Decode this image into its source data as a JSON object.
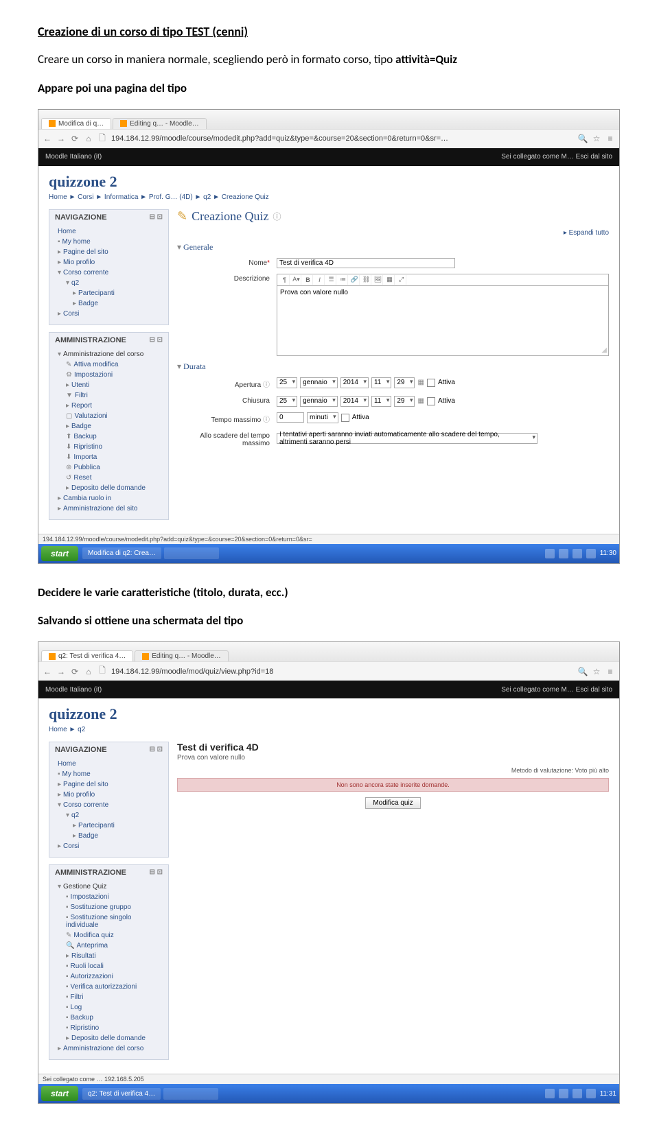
{
  "doc": {
    "heading": "Creazione di un corso di tipo TEST (cenni)",
    "para1_a": "Creare un corso in maniera normale, scegliendo però in formato corso, tipo ",
    "para1_b": "attività=Quiz",
    "para2": "Appare poi una pagina del tipo",
    "para3": "Decidere le varie caratteristiche (titolo, durata, ecc.)",
    "para4": "Salvando si ottiene una schermata del tipo"
  },
  "shot1": {
    "tabs": {
      "t1": "Modifica di q…",
      "t2": "Editing q… - Moodle…"
    },
    "url": "194.184.12.99/moodle/course/modedit.php?add=quiz&type=&course=20&section=0&return=0&sr=…",
    "blackbar_left": "Moodle    Italiano (it)",
    "blackbar_right": "Sei collegato come M…   Esci dal sito",
    "pageTitle": "quizzone 2",
    "breadcrumb": "Home ► Corsi ► Informatica ► Prof. G… (4D) ► q2 ► Creazione Quiz",
    "nav": {
      "header": "NAVIGAZIONE",
      "items": [
        "Home",
        "My home",
        "Pagine del sito",
        "Mio profilo",
        "Corso corrente"
      ],
      "sub": [
        "q2",
        "Partecipanti",
        "Badge"
      ],
      "last": "Corsi"
    },
    "admin": {
      "header": "AMMINISTRAZIONE",
      "head2": "Amministrazione del corso",
      "items": [
        "Attiva modifica",
        "Impostazioni",
        "Utenti",
        "Filtri",
        "Report",
        "Valutazioni",
        "Badge",
        "Backup",
        "Ripristino",
        "Importa",
        "Pubblica",
        "Reset",
        "Deposito delle domande"
      ],
      "tail": [
        "Cambia ruolo in",
        "Amministrazione del sito"
      ]
    },
    "mainHeading": "Creazione Quiz",
    "expand": "▸ Espandi tutto",
    "sec_general": "Generale",
    "lbl_nome": "Nome",
    "val_nome": "Test di verifica 4D",
    "lbl_desc": "Descrizione",
    "val_desc": "Prova con valore nullo",
    "sec_durata": "Durata",
    "lbl_apertura": "Apertura",
    "lbl_chiusura": "Chiusura",
    "lbl_tempomax": "Tempo massimo",
    "lbl_scadere": "Allo scadere del tempo massimo",
    "val_scadere": "I tentativi aperti saranno inviati automaticamente allo scadere del tempo, altrimenti saranno persi",
    "date": {
      "d": "25",
      "m": "gennaio",
      "y": "2014",
      "h": "11",
      "min": "29"
    },
    "attiva": "Attiva",
    "tempo0": "0",
    "sel_minuti": "minuti",
    "footerStatus": "194.184.12.99/moodle/course/modedit.php?add=quiz&type=&course=20&section=0&return=0&sr=",
    "taskbar": {
      "start": "start",
      "t1": "Modifica di q2: Crea…",
      "t2": "",
      "time": "11:30"
    }
  },
  "shot2": {
    "tabs": {
      "t1": "q2: Test di verifica 4…",
      "t2": "Editing q… - Moodle…"
    },
    "url": "194.184.12.99/moodle/mod/quiz/view.php?id=18",
    "blackbar_left": "Moodle    Italiano (it)",
    "blackbar_right": "Sei collegato come M…   Esci dal sito",
    "pageTitle": "quizzone 2",
    "breadcrumb": "Home ► q2",
    "nav": {
      "header": "NAVIGAZIONE",
      "items": [
        "Home",
        "My home",
        "Pagine del sito",
        "Mio profilo",
        "Corso corrente"
      ],
      "sub": [
        "q2",
        "Partecipanti",
        "Badge"
      ],
      "last": "Corsi"
    },
    "admin": {
      "header": "AMMINISTRAZIONE",
      "head2": "Gestione Quiz",
      "items": [
        "Impostazioni",
        "Sostituzione gruppo",
        "Sostituzione singolo individuale",
        "Modifica quiz",
        "Anteprima",
        "Risultati",
        "Ruoli locali",
        "Autorizzazioni",
        "Verifica autorizzazioni",
        "Filtri",
        "Log",
        "Backup",
        "Ripristino",
        "Deposito delle domande"
      ],
      "sec2": "Amministrazione del corso"
    },
    "testTitle": "Test di verifica 4D",
    "testNote": "Prova con valore nullo",
    "metaRight": "Metodo di valutazione: Voto più alto",
    "pink": "Non sono ancora state inserite domande.",
    "btn": "Modifica quiz",
    "footerStatus": "Sei collegato come …  192.168.5.205",
    "taskbar": {
      "start": "start",
      "t1": "q2: Test di verifica 4…",
      "t2": "",
      "time": "11:31"
    }
  }
}
